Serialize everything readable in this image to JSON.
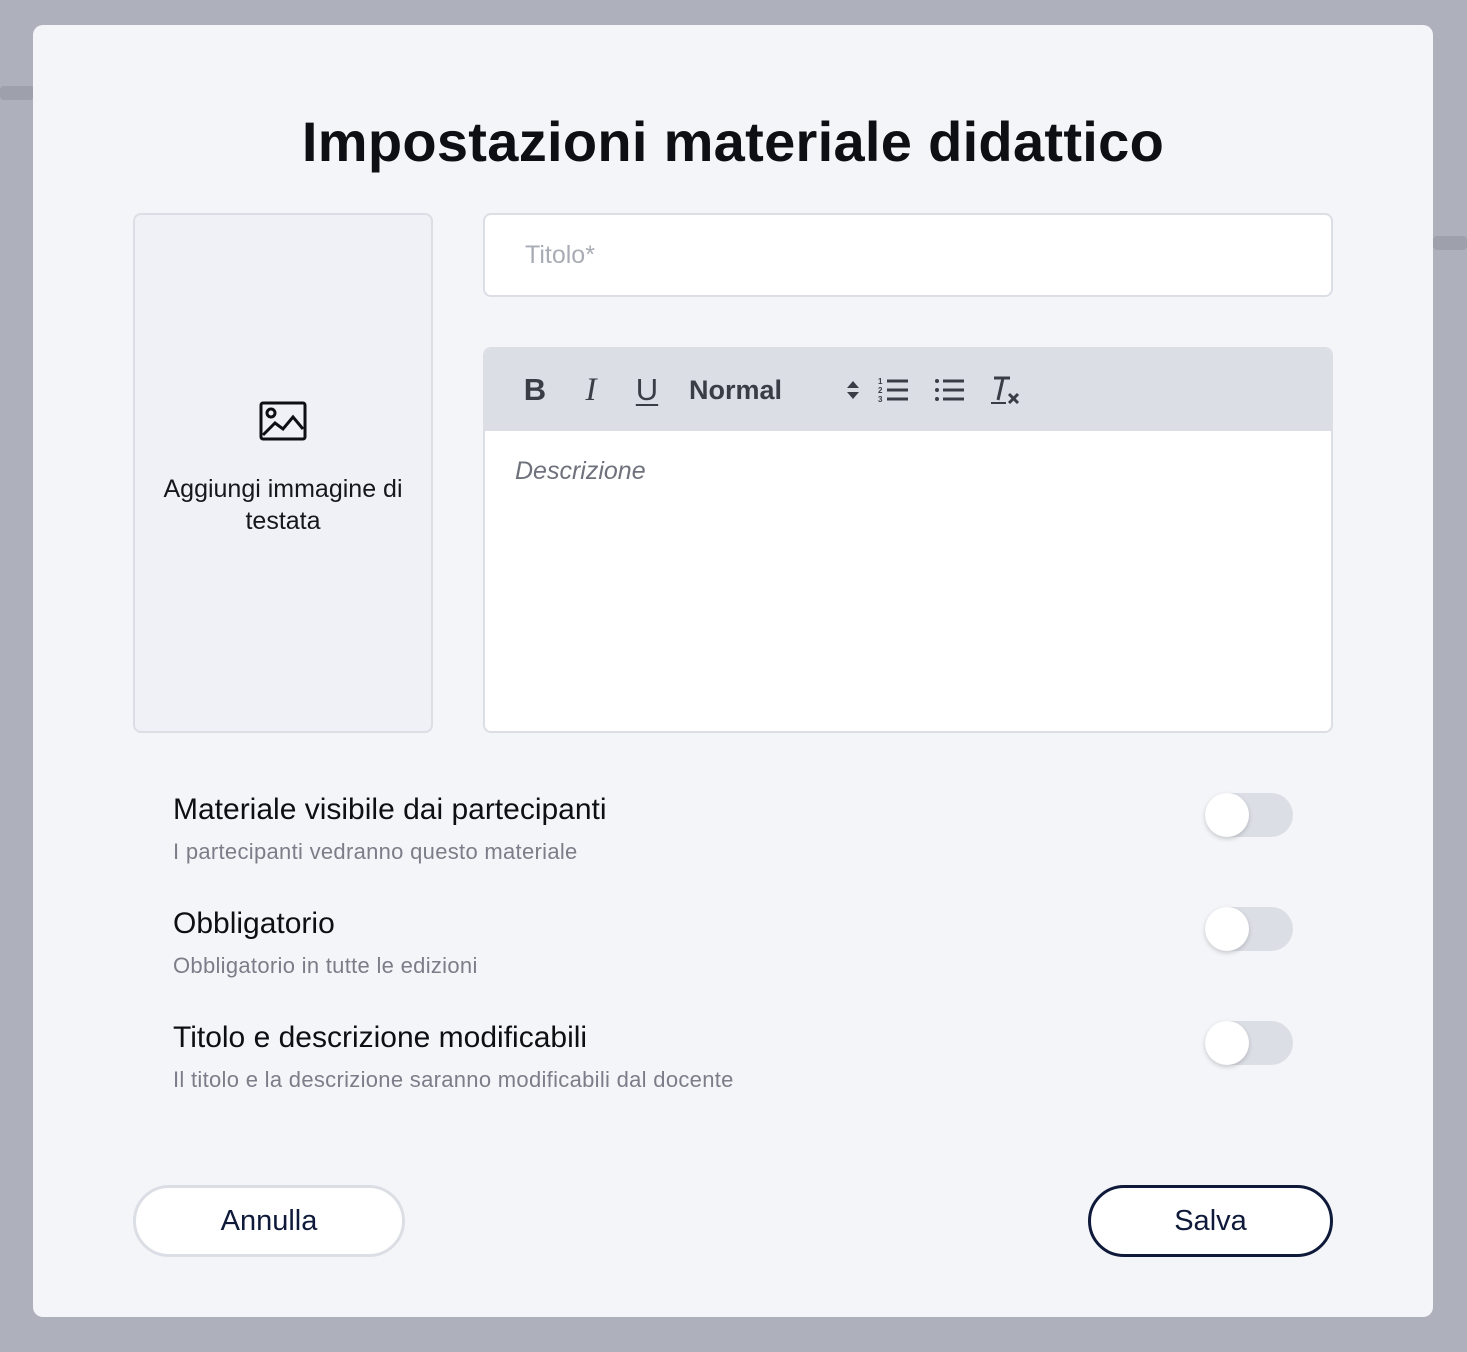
{
  "modal": {
    "title": "Impostazioni materiale didattico"
  },
  "header_image": {
    "label": "Aggiungi immagine di testata",
    "icon": "image-icon"
  },
  "title_field": {
    "value": "",
    "placeholder": "Titolo*"
  },
  "editor": {
    "toolbar": {
      "bold": "B",
      "italic": "I",
      "underline": "U",
      "format_select": "Normal",
      "icons": [
        "bold-icon",
        "italic-icon",
        "underline-icon",
        "select-arrows-icon",
        "ordered-list-icon",
        "bullet-list-icon",
        "clear-format-icon"
      ]
    },
    "placeholder": "Descrizione"
  },
  "settings": [
    {
      "title": "Materiale visibile dai partecipanti",
      "subtitle": "I partecipanti vedranno questo materiale",
      "enabled": false
    },
    {
      "title": "Obbligatorio",
      "subtitle": "Obbligatorio in tutte le edizioni",
      "enabled": false
    },
    {
      "title": "Titolo e descrizione modificabili",
      "subtitle": "Il titolo e la descrizione saranno modificabili dal docente",
      "enabled": false
    }
  ],
  "actions": {
    "cancel_label": "Annulla",
    "save_label": "Salva"
  },
  "colors": {
    "backdrop": "#aeb1bb",
    "modal_bg": "#f4f5f9",
    "border": "#dcdee6",
    "primary": "#0f1a3a"
  }
}
